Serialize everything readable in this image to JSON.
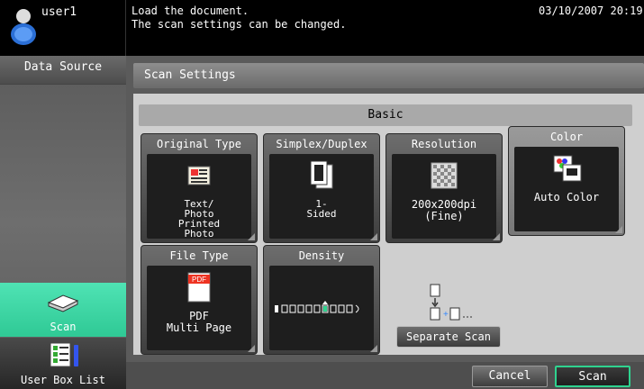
{
  "topbar": {
    "user": "user1",
    "message": "Load the document.\nThe scan settings can be changed.",
    "datetime": "03/10/2007 20:19"
  },
  "sidebar": {
    "header": "Data Source",
    "items": [
      {
        "label": "Scan",
        "icon": "scanner-icon",
        "selected": true
      },
      {
        "label": "User Box List",
        "icon": "user-box-list-icon",
        "selected": false
      }
    ]
  },
  "main": {
    "header": "Scan Settings",
    "basic_label": "Basic",
    "tiles": [
      {
        "title": "Original Type",
        "value": "Text/\nPhoto\nPrinted\nPhoto",
        "icon": "document-photo-icon"
      },
      {
        "title": "Simplex/Duplex",
        "value": "1-\nSided",
        "icon": "pages-icon"
      },
      {
        "title": "Resolution",
        "value": "200x200dpi\n(Fine)",
        "icon": "resolution-icon"
      },
      {
        "title": "Color",
        "value": "Auto Color",
        "icon": "auto-color-icon"
      },
      {
        "title": "File Type",
        "value": "PDF\nMulti Page",
        "icon": "pdf-icon",
        "icon_text": "PDF"
      },
      {
        "title": "Density",
        "value": "",
        "icon": "density-scale-icon"
      }
    ],
    "separate_scan": "Separate Scan",
    "buttons": {
      "cancel": "Cancel",
      "scan": "Scan"
    }
  },
  "colors": {
    "accent": "#2fd38f",
    "scan_highlight": "#39d9a6"
  }
}
